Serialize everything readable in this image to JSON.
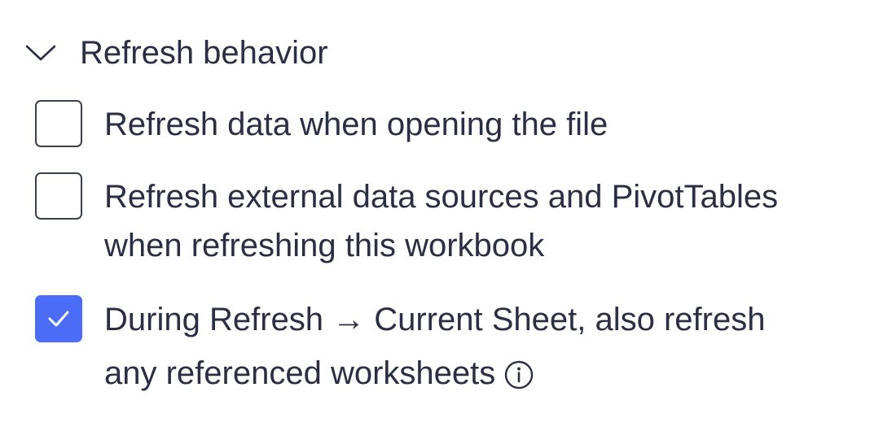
{
  "section": {
    "title": "Refresh behavior",
    "expanded": true,
    "icon": "chevron-down-icon"
  },
  "options": [
    {
      "lines": [
        "Refresh data when opening the file"
      ],
      "checked": false
    },
    {
      "lines": [
        "Refresh external data sources and PivotTables",
        "when refreshing this workbook"
      ],
      "checked": false
    },
    {
      "lines": [
        "During Refresh → Current Sheet, also refresh",
        "any referenced worksheets"
      ],
      "checked": true,
      "info_icon": "info-icon"
    }
  ],
  "colors": {
    "accent": "#4a6cf7",
    "text": "#2b2f45",
    "border": "#3a3f55"
  }
}
